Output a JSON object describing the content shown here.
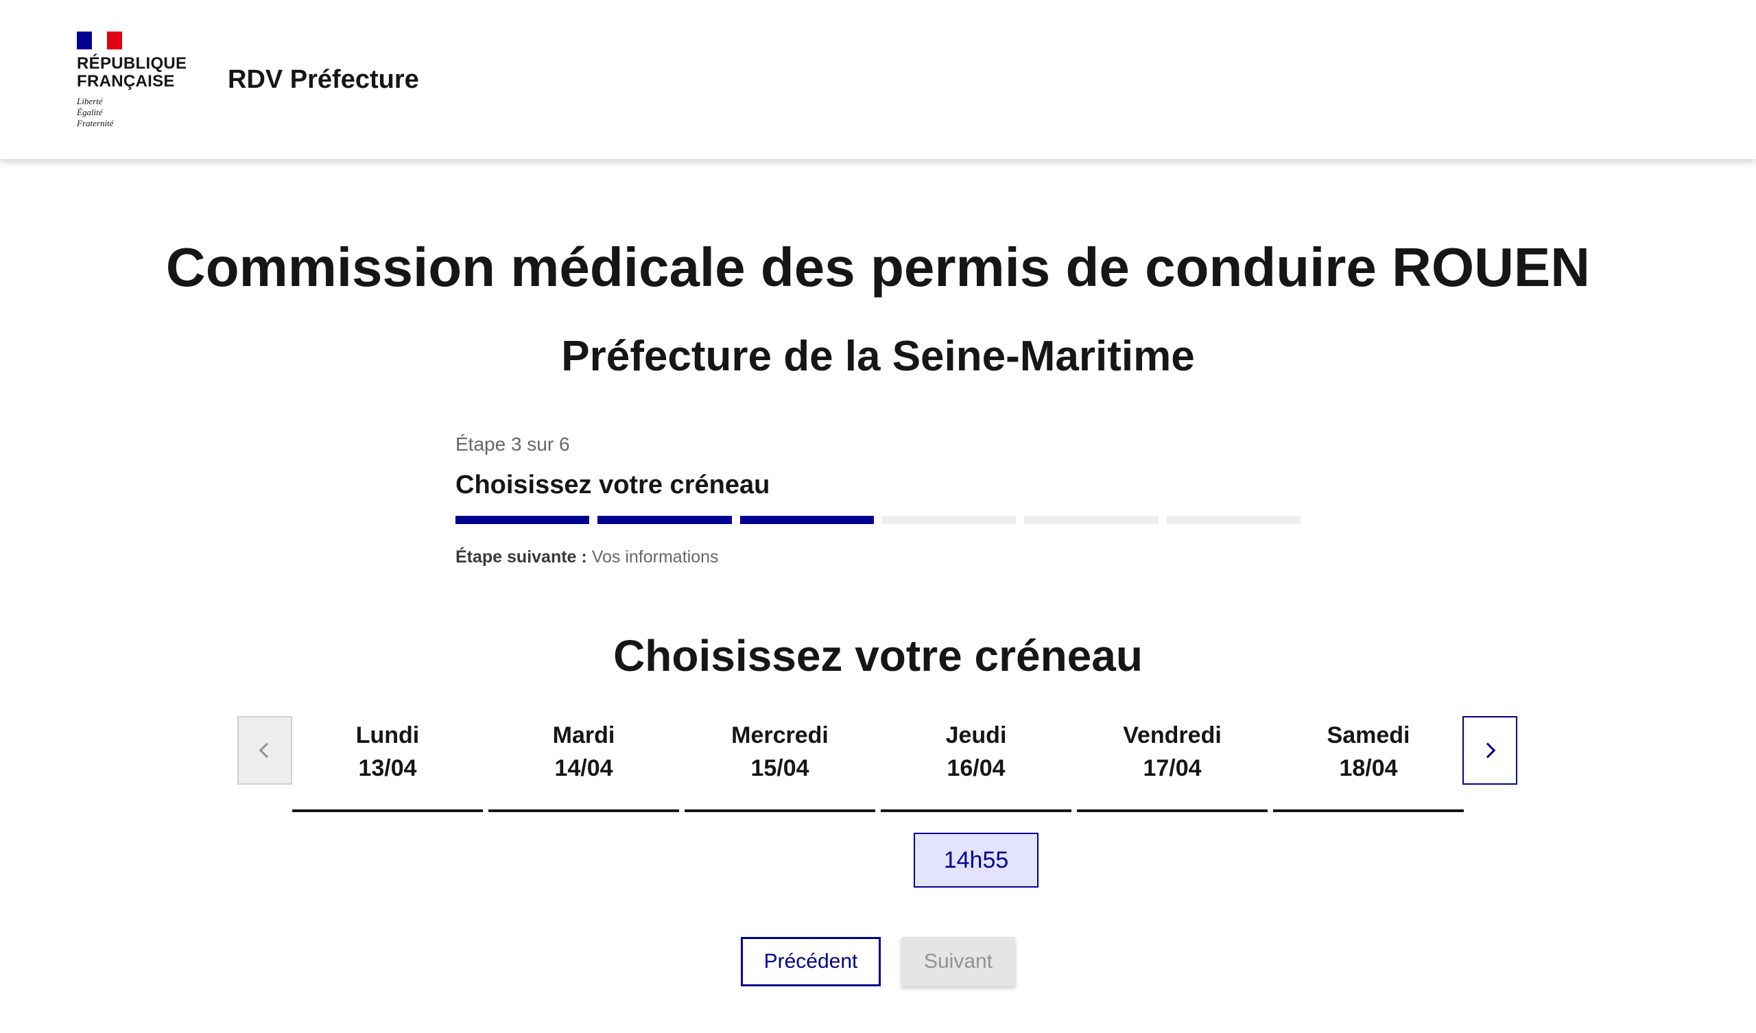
{
  "header": {
    "republique": "RÉPUBLIQUE\nFRANÇAISE",
    "motto": "Liberté\nÉgalité\nFraternité",
    "service_title": "RDV Préfecture"
  },
  "page": {
    "title": "Commission médicale des permis de conduire ROUEN",
    "subtitle": "Préfecture de la Seine-Maritime"
  },
  "stepper": {
    "state": "Étape 3 sur 6",
    "title": "Choisissez votre créneau",
    "current_step": 3,
    "total_steps": 6,
    "next_label": "Étape suivante :",
    "next_value": "Vos informations"
  },
  "section": {
    "title": "Choisissez votre créneau"
  },
  "carousel": {
    "days": [
      {
        "name": "Lundi",
        "date": "13/04"
      },
      {
        "name": "Mardi",
        "date": "14/04"
      },
      {
        "name": "Mercredi",
        "date": "15/04"
      },
      {
        "name": "Jeudi",
        "date": "16/04"
      },
      {
        "name": "Vendredi",
        "date": "17/04"
      },
      {
        "name": "Samedi",
        "date": "18/04"
      }
    ],
    "slot": {
      "day": "Jeudi 16/04",
      "time": "14h55"
    }
  },
  "actions": {
    "previous": "Précédent",
    "next": "Suivant"
  },
  "colors": {
    "primary": "#000091",
    "slot_bg": "#e3e3fd",
    "disabled_bg": "#e5e5e5",
    "flag_red": "#e1000f"
  }
}
